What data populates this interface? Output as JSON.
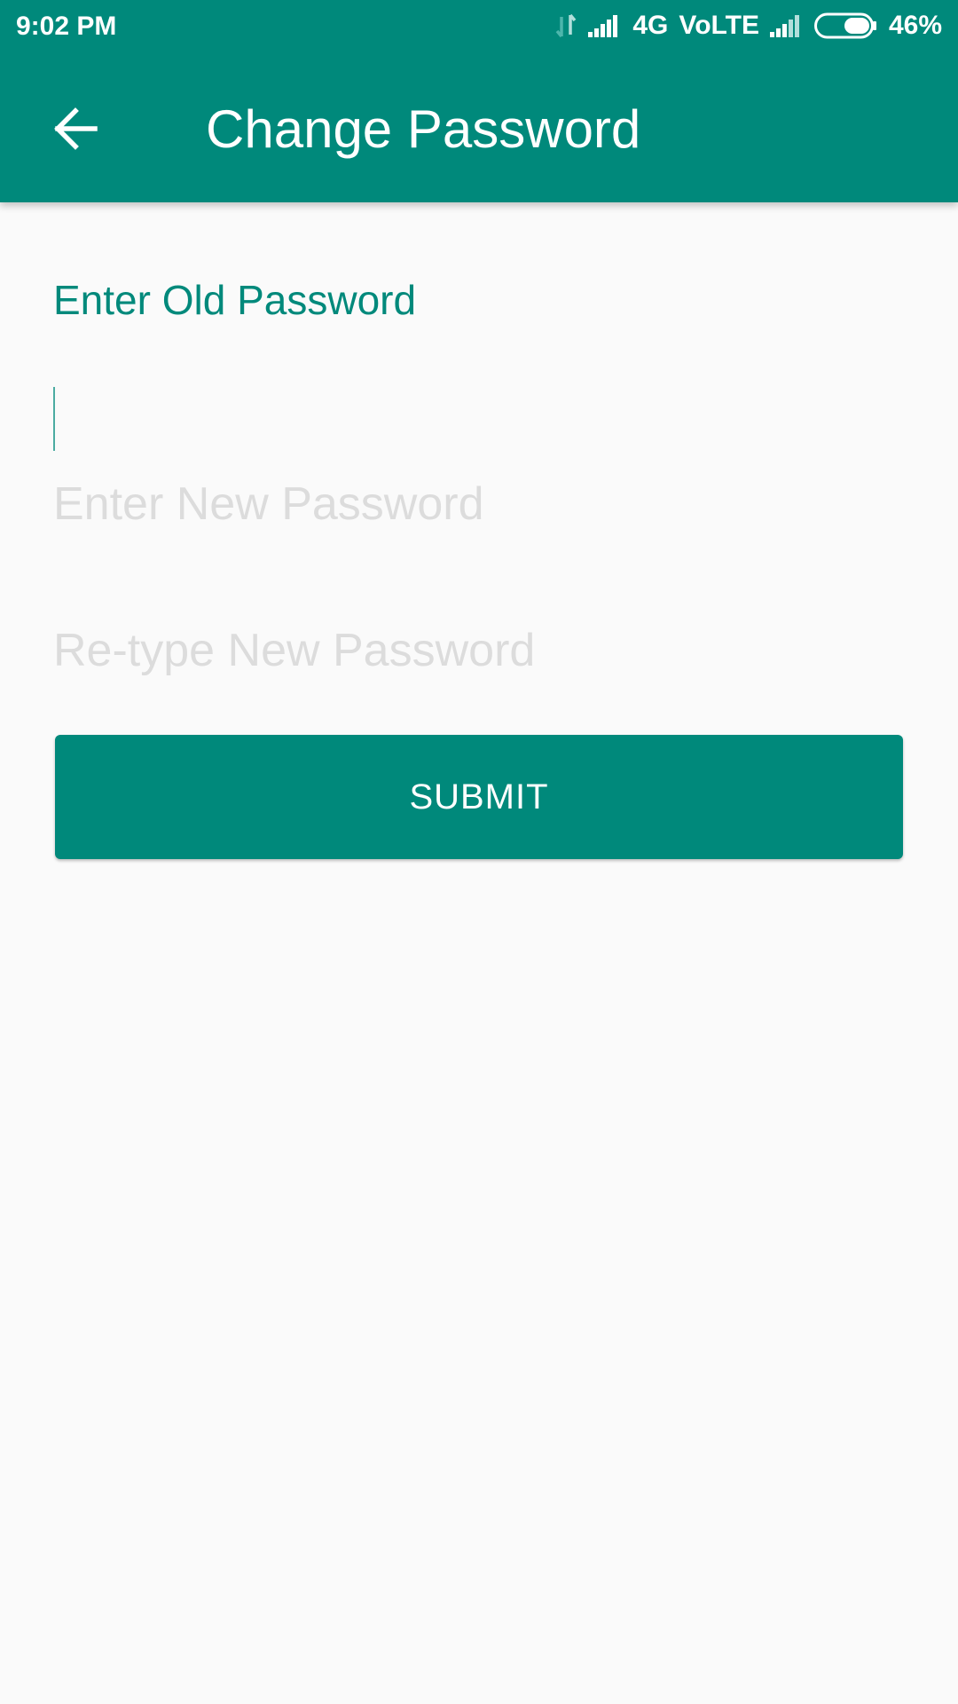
{
  "status_bar": {
    "time": "9:02 PM",
    "network": "4G",
    "volte": "VoLTE",
    "battery": "46%",
    "icons": [
      "data-arrows-icon",
      "signal-icon",
      "signal-icon",
      "battery-icon"
    ]
  },
  "toolbar": {
    "back_icon": "arrow-left-icon",
    "title": "Change Password"
  },
  "form": {
    "old_password": {
      "label": "Enter Old Password",
      "value": ""
    },
    "new_password": {
      "placeholder": "Enter New Password",
      "value": ""
    },
    "retype_password": {
      "placeholder": "Re-type New Password",
      "value": ""
    },
    "submit_label": "SUBMIT"
  },
  "colors": {
    "primary": "#00897b",
    "background": "#fafafa",
    "hint": "#dcdcdc"
  }
}
